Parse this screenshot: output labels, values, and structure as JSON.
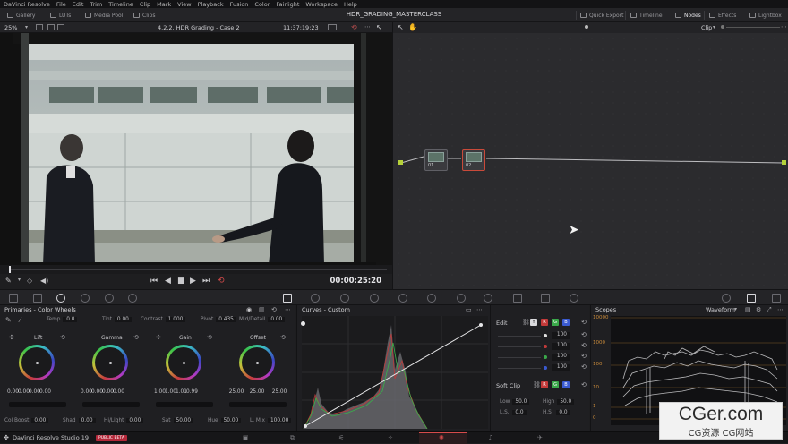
{
  "menu": [
    "DaVinci Resolve",
    "File",
    "Edit",
    "Trim",
    "Timeline",
    "Clip",
    "Mark",
    "View",
    "Playback",
    "Fusion",
    "Color",
    "Fairlight",
    "Workspace",
    "Help"
  ],
  "toolbar": {
    "gallery": "Gallery",
    "luts": "LUTs",
    "media_pool": "Media Pool",
    "clips": "Clips",
    "project_title": "HDR_GRADING_MASTERCLASS",
    "quick_export": "Quick Export",
    "timeline": "Timeline",
    "nodes": "Nodes",
    "effects": "Effects",
    "lightbox": "Lightbox"
  },
  "viewer": {
    "zoom": "25%",
    "clip_name": "4.2.2. HDR Grading - Case 2",
    "timecode_top": "11:37:19:23",
    "timecode": "00:00:25:20"
  },
  "nodes": {
    "mode": "Clip",
    "node1": "01",
    "node2": "02"
  },
  "primaries": {
    "title": "Primaries - Color Wheels",
    "top": {
      "temp_label": "Temp",
      "temp": "0.0",
      "tint_label": "Tint",
      "tint": "0.00",
      "contrast_label": "Contrast",
      "contrast": "1.000",
      "pivot_label": "Pivot",
      "pivot": "0.435",
      "middetail_label": "Mid/Detail",
      "middetail": "0.00"
    },
    "wheels": [
      {
        "name": "Lift",
        "values": [
          "0.00",
          "0.00",
          "0.00",
          "0.00"
        ]
      },
      {
        "name": "Gamma",
        "values": [
          "0.00",
          "0.00",
          "0.00",
          "0.00"
        ]
      },
      {
        "name": "Gain",
        "values": [
          "1.00",
          "1.00",
          "1.01",
          "0.99"
        ]
      },
      {
        "name": "Offset",
        "values": [
          "25.00",
          "25.00",
          "25.00"
        ]
      }
    ],
    "bottom": {
      "colboost_label": "Col Boost",
      "colboost": "0.00",
      "shad_label": "Shad",
      "shad": "0.00",
      "hilight_label": "Hi/Light",
      "hilight": "0.00",
      "sat_label": "Sat",
      "sat": "50.00",
      "hue_label": "Hue",
      "hue": "50.00",
      "lmix_label": "L. Mix",
      "lmix": "100.00"
    }
  },
  "curves": {
    "title": "Curves - Custom"
  },
  "curve_edit": {
    "edit_label": "Edit",
    "y": "Y",
    "r": "R",
    "g": "G",
    "b": "B",
    "values": [
      "100",
      "100",
      "100",
      "100"
    ],
    "soft_clip": "Soft Clip",
    "low_label": "Low",
    "low": "50.0",
    "high_label": "High",
    "high": "50.0",
    "ls_label": "L.S.",
    "ls": "0.0",
    "hs_label": "H.S.",
    "hs": "0.0"
  },
  "scopes": {
    "title": "Scopes",
    "type": "Waveform",
    "ticks": [
      "10000",
      "1000",
      "100",
      "10",
      "1",
      "0"
    ]
  },
  "status": {
    "app": "DaVinci Resolve Studio 19",
    "badge": "PUBLIC BETA"
  },
  "colors": {
    "accent": "#d74b4b",
    "panel": "#1f1f22"
  },
  "watermark": {
    "line1": "CGer.com",
    "line2": "CG资源 CG网站"
  }
}
